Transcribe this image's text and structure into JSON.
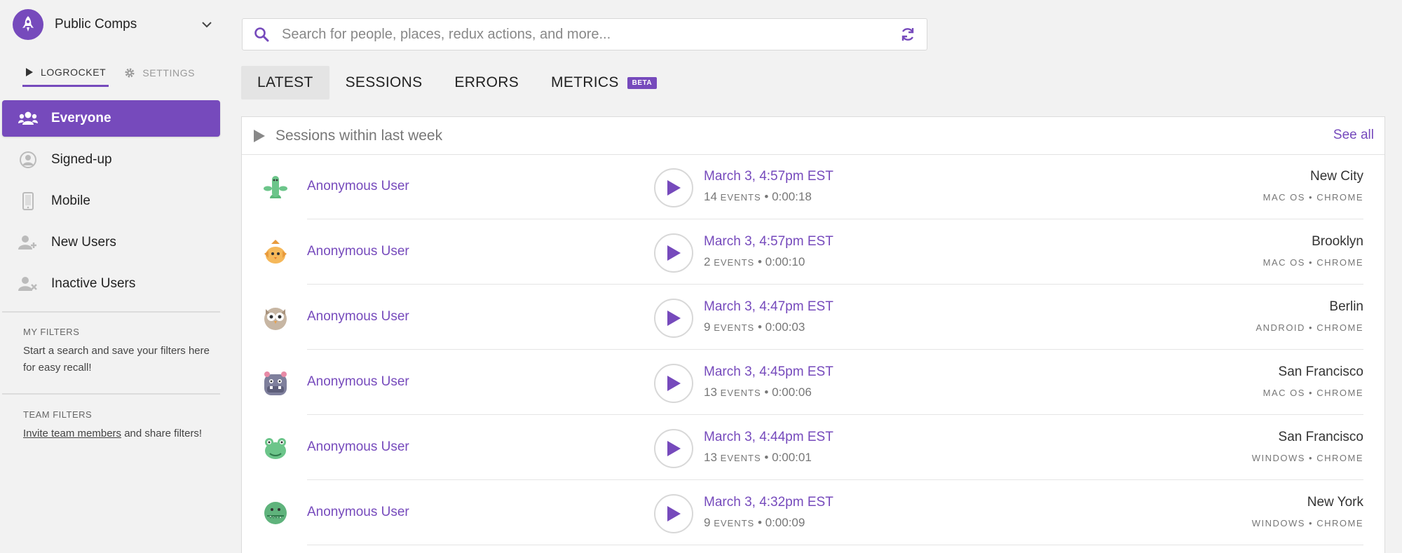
{
  "org": {
    "name": "Public Comps"
  },
  "modes": [
    {
      "label": "LOGROCKET",
      "icon": "play-icon",
      "active": true
    },
    {
      "label": "SETTINGS",
      "icon": "gear-icon",
      "active": false
    }
  ],
  "nav": [
    {
      "label": "Everyone",
      "icon": "people-group-icon",
      "active": true
    },
    {
      "label": "Signed-up",
      "icon": "user-circle-icon",
      "active": false
    },
    {
      "label": "Mobile",
      "icon": "mobile-phone-icon",
      "active": false
    },
    {
      "label": "New Users",
      "icon": "user-plus-icon",
      "active": false
    },
    {
      "label": "Inactive Users",
      "icon": "user-x-icon",
      "active": false
    }
  ],
  "my_filters": {
    "heading": "MY FILTERS",
    "text": "Start a search and save your filters here for easy recall!"
  },
  "team_filters": {
    "heading": "TEAM FILTERS",
    "link": "Invite team members",
    "text": " and share filters!"
  },
  "search": {
    "placeholder": "Search for people, places, redux actions, and more...",
    "value": ""
  },
  "tabs": [
    {
      "label": "LATEST",
      "active": true
    },
    {
      "label": "SESSIONS",
      "active": false
    },
    {
      "label": "ERRORS",
      "active": false
    },
    {
      "label": "METRICS",
      "active": false,
      "badge": "BETA"
    }
  ],
  "sessions": {
    "title": "Sessions within last week",
    "see_all": "See all",
    "events_label": "EVENTS",
    "rows": [
      {
        "user": "Anonymous User",
        "avatar": "green-worm-avatar",
        "time": "March 3, 4:57pm EST",
        "events": "14",
        "duration": "0:00:18",
        "city": "New City",
        "os": "MAC OS",
        "browser": "CHROME"
      },
      {
        "user": "Anonymous User",
        "avatar": "orange-bird-avatar",
        "time": "March 3, 4:57pm EST",
        "events": "2",
        "duration": "0:00:10",
        "city": "Brooklyn",
        "os": "MAC OS",
        "browser": "CHROME"
      },
      {
        "user": "Anonymous User",
        "avatar": "owl-avatar",
        "time": "March 3, 4:47pm EST",
        "events": "9",
        "duration": "0:00:03",
        "city": "Berlin",
        "os": "ANDROID",
        "browser": "CHROME"
      },
      {
        "user": "Anonymous User",
        "avatar": "hippo-avatar",
        "time": "March 3, 4:45pm EST",
        "events": "13",
        "duration": "0:00:06",
        "city": "San Francisco",
        "os": "MAC OS",
        "browser": "CHROME"
      },
      {
        "user": "Anonymous User",
        "avatar": "frog-avatar",
        "time": "March 3, 4:44pm EST",
        "events": "13",
        "duration": "0:00:01",
        "city": "San Francisco",
        "os": "WINDOWS",
        "browser": "CHROME"
      },
      {
        "user": "Anonymous User",
        "avatar": "crocodile-avatar",
        "time": "March 3, 4:32pm EST",
        "events": "9",
        "duration": "0:00:09",
        "city": "New York",
        "os": "WINDOWS",
        "browser": "CHROME"
      }
    ]
  },
  "colors": {
    "accent": "#764abc",
    "background": "#f2f2f2",
    "panel": "#ffffff"
  }
}
